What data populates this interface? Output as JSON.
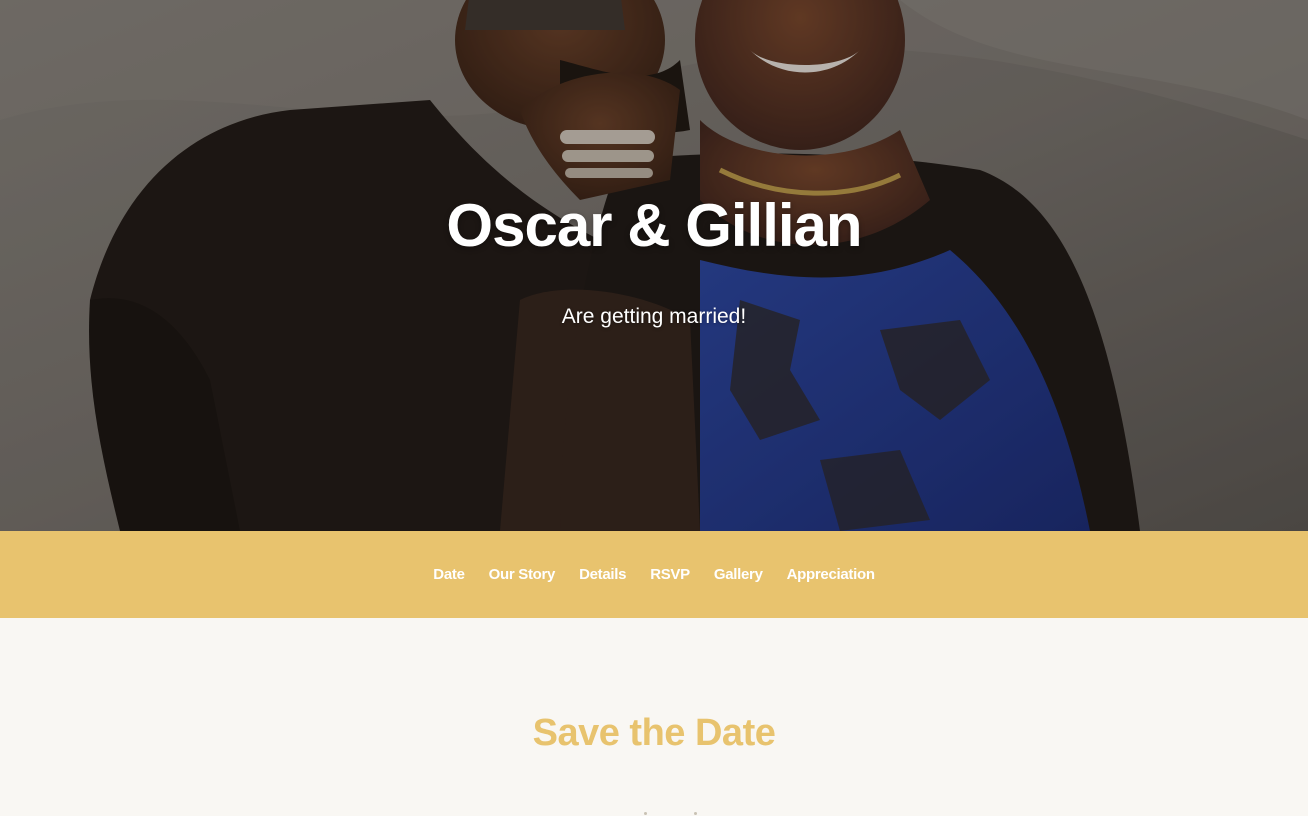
{
  "hero": {
    "title": "Oscar & Gillian",
    "subtitle": "Are getting married!",
    "photo": "couple-photo"
  },
  "nav": {
    "items": [
      {
        "label": "Date"
      },
      {
        "label": "Our Story"
      },
      {
        "label": "Details"
      },
      {
        "label": "RSVP"
      },
      {
        "label": "Gallery"
      },
      {
        "label": "Appreciation"
      }
    ]
  },
  "save_the_date": {
    "title": "Save the Date"
  },
  "colors": {
    "accent": "#e8c36e",
    "background": "#f9f7f3",
    "hero_text": "#ffffff"
  }
}
